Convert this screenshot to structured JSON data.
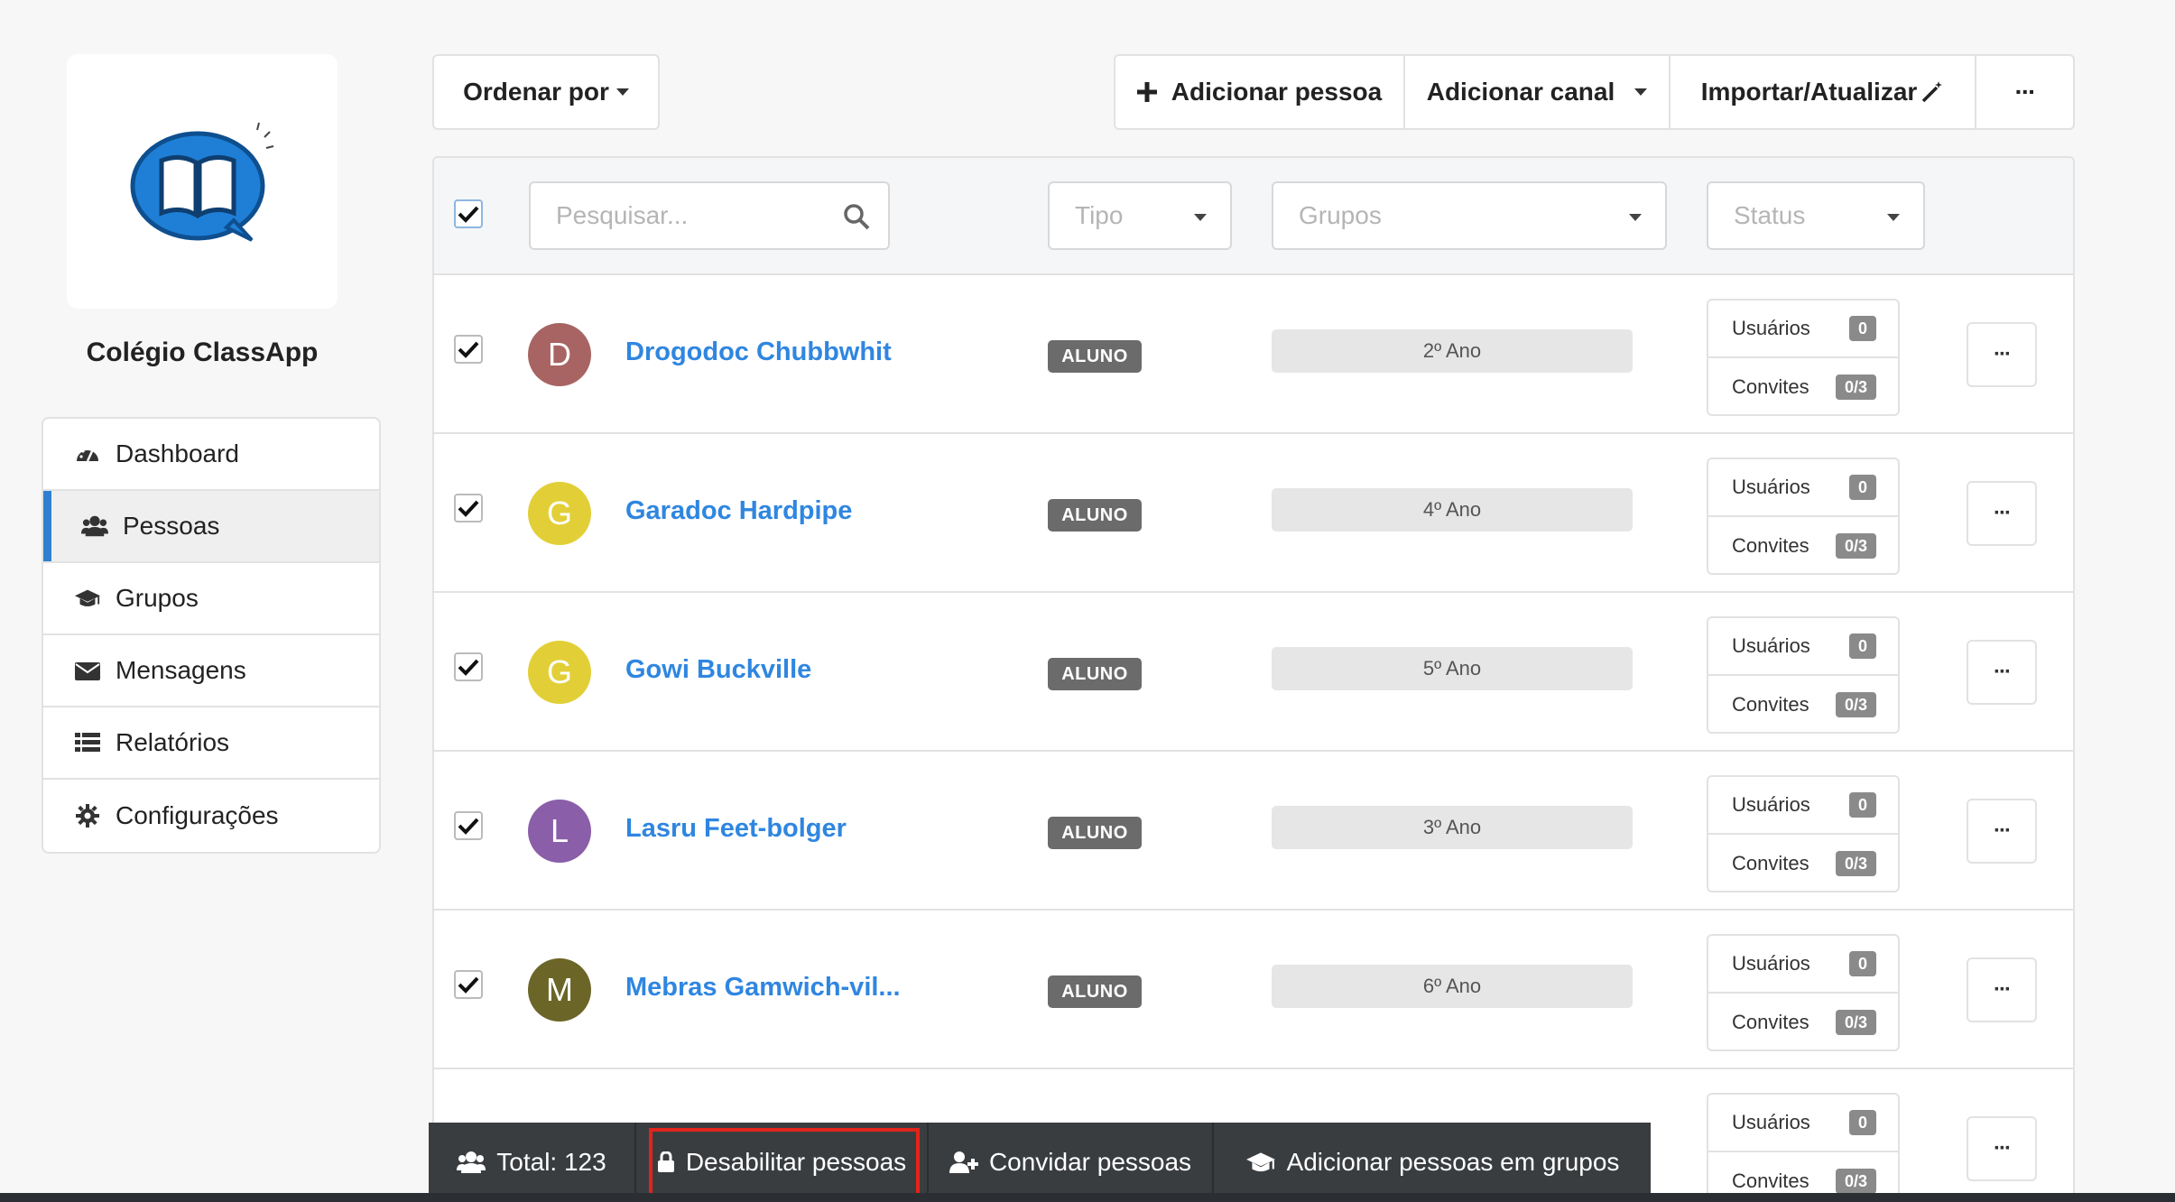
{
  "organization": {
    "name": "Colégio ClassApp"
  },
  "nav": {
    "items": [
      {
        "label": "Dashboard",
        "icon": "dashboard-icon"
      },
      {
        "label": "Pessoas",
        "icon": "users-icon",
        "active": true
      },
      {
        "label": "Grupos",
        "icon": "graduation-cap-icon"
      },
      {
        "label": "Mensagens",
        "icon": "envelope-icon"
      },
      {
        "label": "Relatórios",
        "icon": "list-icon"
      },
      {
        "label": "Configurações",
        "icon": "gear-icon"
      }
    ]
  },
  "toolbar": {
    "order_label": "Ordenar por",
    "add_person_label": "Adicionar pessoa",
    "add_channel_label": "Adicionar canal",
    "import_label": "Importar/Atualizar",
    "more_label": "···"
  },
  "filters": {
    "search_placeholder": "Pesquisar...",
    "type_placeholder": "Tipo",
    "groups_placeholder": "Grupos",
    "status_placeholder": "Status"
  },
  "people": [
    {
      "initial": "D",
      "name": "Drogodoc Chubbwhit",
      "type": "ALUNO",
      "group": "2º Ano",
      "color": "#a86462",
      "users_label": "Usuários",
      "users": "0",
      "invites_label": "Convites",
      "invites": "0/3"
    },
    {
      "initial": "G",
      "name": "Garadoc Hardpipe",
      "type": "ALUNO",
      "group": "4º Ano",
      "color": "#e2cf37",
      "users_label": "Usuários",
      "users": "0",
      "invites_label": "Convites",
      "invites": "0/3"
    },
    {
      "initial": "G",
      "name": "Gowi Buckville",
      "type": "ALUNO",
      "group": "5º Ano",
      "color": "#e2cf37",
      "users_label": "Usuários",
      "users": "0",
      "invites_label": "Convites",
      "invites": "0/3"
    },
    {
      "initial": "L",
      "name": "Lasru Feet-bolger",
      "type": "ALUNO",
      "group": "3º Ano",
      "color": "#8a5ea8",
      "users_label": "Usuários",
      "users": "0",
      "invites_label": "Convites",
      "invites": "0/3"
    },
    {
      "initial": "M",
      "name": "Mebras Gamwich-vil...",
      "type": "ALUNO",
      "group": "6º Ano",
      "color": "#6b6528",
      "users_label": "Usuários",
      "users": "0",
      "invites_label": "Convites",
      "invites": "0/3"
    },
    {
      "initial": "",
      "name": "",
      "type": "",
      "group": "",
      "color": "#e8702a",
      "users_label": "Usuários",
      "users": "0",
      "invites_label": "Convites",
      "invites": "0/3"
    }
  ],
  "row_more_label": "···",
  "action_bar": {
    "total_label": "Total: 123",
    "disable_label": "Desabilitar pessoas",
    "invite_label": "Convidar pessoas",
    "add_to_groups_label": "Adicionar pessoas em grupos"
  },
  "colors": {
    "accent": "#2f7fd0",
    "link": "#2f86e0",
    "highlight": "#e3241b"
  }
}
